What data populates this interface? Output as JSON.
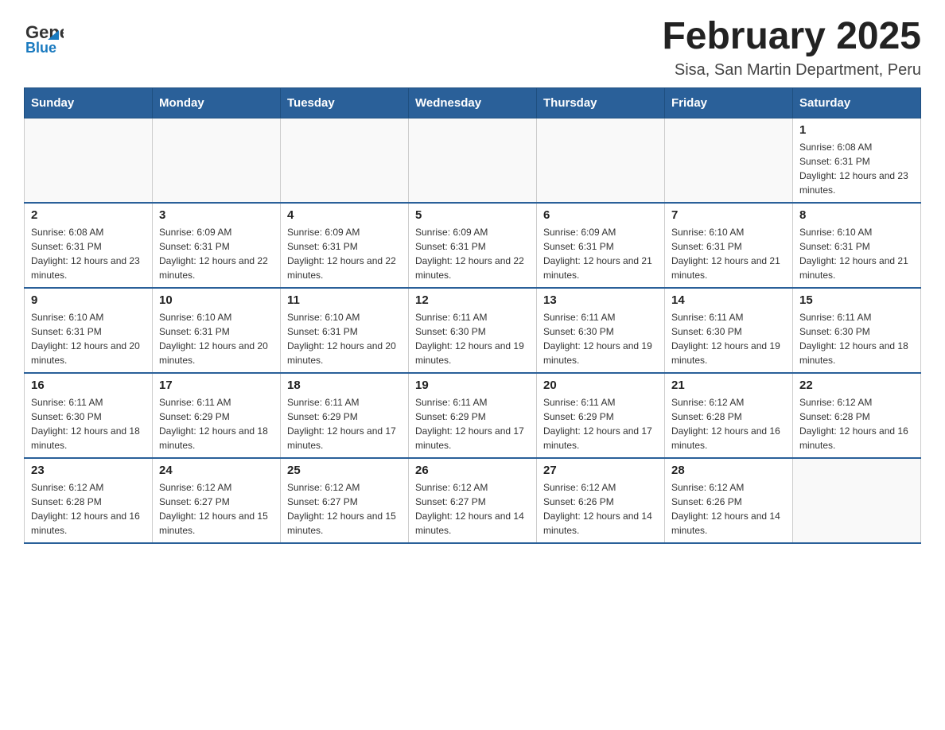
{
  "header": {
    "logo_general": "General",
    "logo_blue": "Blue",
    "title": "February 2025",
    "subtitle": "Sisa, San Martin Department, Peru"
  },
  "weekdays": [
    "Sunday",
    "Monday",
    "Tuesday",
    "Wednesday",
    "Thursday",
    "Friday",
    "Saturday"
  ],
  "weeks": [
    [
      {
        "day": "",
        "sunrise": "",
        "sunset": "",
        "daylight": ""
      },
      {
        "day": "",
        "sunrise": "",
        "sunset": "",
        "daylight": ""
      },
      {
        "day": "",
        "sunrise": "",
        "sunset": "",
        "daylight": ""
      },
      {
        "day": "",
        "sunrise": "",
        "sunset": "",
        "daylight": ""
      },
      {
        "day": "",
        "sunrise": "",
        "sunset": "",
        "daylight": ""
      },
      {
        "day": "",
        "sunrise": "",
        "sunset": "",
        "daylight": ""
      },
      {
        "day": "1",
        "sunrise": "Sunrise: 6:08 AM",
        "sunset": "Sunset: 6:31 PM",
        "daylight": "Daylight: 12 hours and 23 minutes."
      }
    ],
    [
      {
        "day": "2",
        "sunrise": "Sunrise: 6:08 AM",
        "sunset": "Sunset: 6:31 PM",
        "daylight": "Daylight: 12 hours and 23 minutes."
      },
      {
        "day": "3",
        "sunrise": "Sunrise: 6:09 AM",
        "sunset": "Sunset: 6:31 PM",
        "daylight": "Daylight: 12 hours and 22 minutes."
      },
      {
        "day": "4",
        "sunrise": "Sunrise: 6:09 AM",
        "sunset": "Sunset: 6:31 PM",
        "daylight": "Daylight: 12 hours and 22 minutes."
      },
      {
        "day": "5",
        "sunrise": "Sunrise: 6:09 AM",
        "sunset": "Sunset: 6:31 PM",
        "daylight": "Daylight: 12 hours and 22 minutes."
      },
      {
        "day": "6",
        "sunrise": "Sunrise: 6:09 AM",
        "sunset": "Sunset: 6:31 PM",
        "daylight": "Daylight: 12 hours and 21 minutes."
      },
      {
        "day": "7",
        "sunrise": "Sunrise: 6:10 AM",
        "sunset": "Sunset: 6:31 PM",
        "daylight": "Daylight: 12 hours and 21 minutes."
      },
      {
        "day": "8",
        "sunrise": "Sunrise: 6:10 AM",
        "sunset": "Sunset: 6:31 PM",
        "daylight": "Daylight: 12 hours and 21 minutes."
      }
    ],
    [
      {
        "day": "9",
        "sunrise": "Sunrise: 6:10 AM",
        "sunset": "Sunset: 6:31 PM",
        "daylight": "Daylight: 12 hours and 20 minutes."
      },
      {
        "day": "10",
        "sunrise": "Sunrise: 6:10 AM",
        "sunset": "Sunset: 6:31 PM",
        "daylight": "Daylight: 12 hours and 20 minutes."
      },
      {
        "day": "11",
        "sunrise": "Sunrise: 6:10 AM",
        "sunset": "Sunset: 6:31 PM",
        "daylight": "Daylight: 12 hours and 20 minutes."
      },
      {
        "day": "12",
        "sunrise": "Sunrise: 6:11 AM",
        "sunset": "Sunset: 6:30 PM",
        "daylight": "Daylight: 12 hours and 19 minutes."
      },
      {
        "day": "13",
        "sunrise": "Sunrise: 6:11 AM",
        "sunset": "Sunset: 6:30 PM",
        "daylight": "Daylight: 12 hours and 19 minutes."
      },
      {
        "day": "14",
        "sunrise": "Sunrise: 6:11 AM",
        "sunset": "Sunset: 6:30 PM",
        "daylight": "Daylight: 12 hours and 19 minutes."
      },
      {
        "day": "15",
        "sunrise": "Sunrise: 6:11 AM",
        "sunset": "Sunset: 6:30 PM",
        "daylight": "Daylight: 12 hours and 18 minutes."
      }
    ],
    [
      {
        "day": "16",
        "sunrise": "Sunrise: 6:11 AM",
        "sunset": "Sunset: 6:30 PM",
        "daylight": "Daylight: 12 hours and 18 minutes."
      },
      {
        "day": "17",
        "sunrise": "Sunrise: 6:11 AM",
        "sunset": "Sunset: 6:29 PM",
        "daylight": "Daylight: 12 hours and 18 minutes."
      },
      {
        "day": "18",
        "sunrise": "Sunrise: 6:11 AM",
        "sunset": "Sunset: 6:29 PM",
        "daylight": "Daylight: 12 hours and 17 minutes."
      },
      {
        "day": "19",
        "sunrise": "Sunrise: 6:11 AM",
        "sunset": "Sunset: 6:29 PM",
        "daylight": "Daylight: 12 hours and 17 minutes."
      },
      {
        "day": "20",
        "sunrise": "Sunrise: 6:11 AM",
        "sunset": "Sunset: 6:29 PM",
        "daylight": "Daylight: 12 hours and 17 minutes."
      },
      {
        "day": "21",
        "sunrise": "Sunrise: 6:12 AM",
        "sunset": "Sunset: 6:28 PM",
        "daylight": "Daylight: 12 hours and 16 minutes."
      },
      {
        "day": "22",
        "sunrise": "Sunrise: 6:12 AM",
        "sunset": "Sunset: 6:28 PM",
        "daylight": "Daylight: 12 hours and 16 minutes."
      }
    ],
    [
      {
        "day": "23",
        "sunrise": "Sunrise: 6:12 AM",
        "sunset": "Sunset: 6:28 PM",
        "daylight": "Daylight: 12 hours and 16 minutes."
      },
      {
        "day": "24",
        "sunrise": "Sunrise: 6:12 AM",
        "sunset": "Sunset: 6:27 PM",
        "daylight": "Daylight: 12 hours and 15 minutes."
      },
      {
        "day": "25",
        "sunrise": "Sunrise: 6:12 AM",
        "sunset": "Sunset: 6:27 PM",
        "daylight": "Daylight: 12 hours and 15 minutes."
      },
      {
        "day": "26",
        "sunrise": "Sunrise: 6:12 AM",
        "sunset": "Sunset: 6:27 PM",
        "daylight": "Daylight: 12 hours and 14 minutes."
      },
      {
        "day": "27",
        "sunrise": "Sunrise: 6:12 AM",
        "sunset": "Sunset: 6:26 PM",
        "daylight": "Daylight: 12 hours and 14 minutes."
      },
      {
        "day": "28",
        "sunrise": "Sunrise: 6:12 AM",
        "sunset": "Sunset: 6:26 PM",
        "daylight": "Daylight: 12 hours and 14 minutes."
      },
      {
        "day": "",
        "sunrise": "",
        "sunset": "",
        "daylight": ""
      }
    ]
  ]
}
